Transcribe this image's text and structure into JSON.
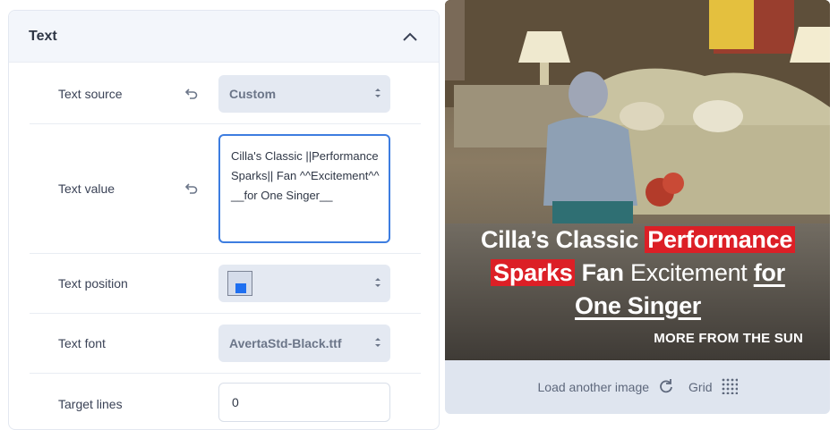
{
  "section": {
    "title": "Text"
  },
  "fields": {
    "text_source": {
      "label": "Text source",
      "value": "Custom"
    },
    "text_value": {
      "label": "Text value",
      "value": "Cilla's Classic ||Performance Sparks|| Fan ^^Excitement^^ __for One Singer__"
    },
    "text_position": {
      "label": "Text position"
    },
    "text_font": {
      "label": "Text font",
      "value": "AvertaStd-Black.ttf"
    },
    "target_lines": {
      "label": "Target lines",
      "value": "0"
    }
  },
  "preview": {
    "caption": {
      "part1": "Cilla’s Classic ",
      "highlight1": "Performance",
      "highlight2": "Sparks",
      "part2": " Fan ",
      "light": "Excitement",
      "underline1": "for",
      "underline2": "One Singer"
    },
    "source_tag": "MORE FROM THE SUN",
    "load_label": "Load another image",
    "grid_label": "Grid"
  },
  "colors": {
    "accent": "#3d7de0",
    "highlight": "#dc1f26",
    "position_marker": "#1f6ff0"
  }
}
